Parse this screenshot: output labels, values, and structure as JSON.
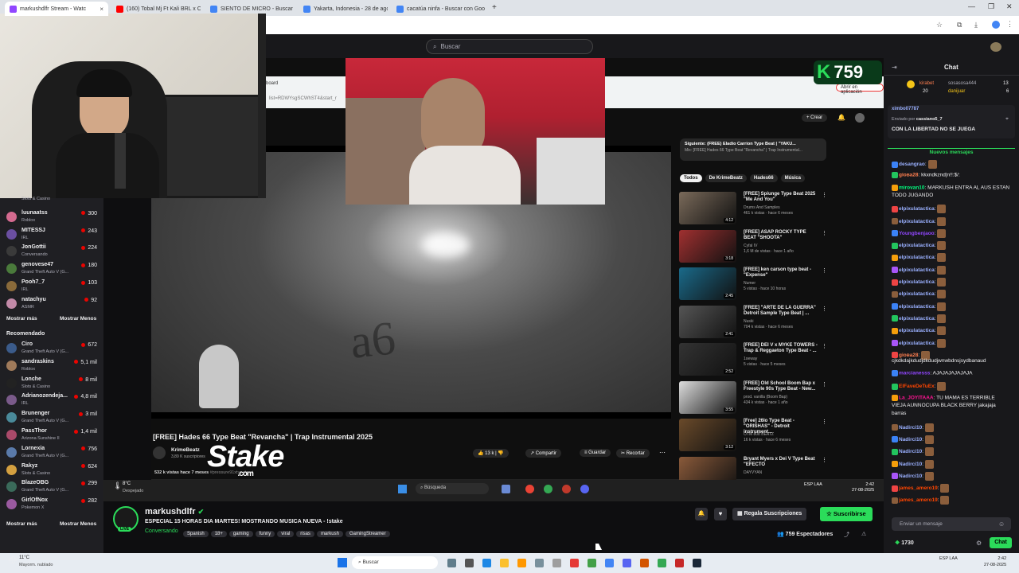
{
  "browser": {
    "tabs": [
      {
        "label": "markushdlfr Stream - Watc",
        "color": "#9146ff",
        "active": true
      },
      {
        "label": "(160) Tobal Mj Ft Kali BRL x Cri",
        "color": "#ff0000",
        "active": false
      },
      {
        "label": "SIENTO DE MICRO - Buscar con",
        "color": "#4285f4",
        "active": false
      },
      {
        "label": "Yakarta, Indonesia - 28 de agos",
        "color": "#4285f4",
        "active": false
      },
      {
        "label": "cacatúa ninfa - Buscar con Goo",
        "color": "#4285f4",
        "active": false
      }
    ]
  },
  "twitch": {
    "search_placeholder": "Buscar",
    "chat_title": "Chat",
    "sidebar": {
      "followed": [
        {
          "name": "",
          "game": "Slots & Casino",
          "viewers": "",
          "color": "#5c4b3a"
        },
        {
          "name": "luunaatss",
          "game": "Roblox",
          "viewers": "300",
          "color": "#d46a8f"
        },
        {
          "name": "MITESSJ",
          "game": "IRL",
          "viewers": "243",
          "color": "#6b4fa1"
        },
        {
          "name": "JonGottii",
          "game": "Conversando",
          "viewers": "224",
          "color": "#3a3a3a"
        },
        {
          "name": "genovese47",
          "game": "Grand Theft Auto V (G...",
          "viewers": "180",
          "color": "#4a7a3b"
        },
        {
          "name": "Pooh7_7",
          "game": "IRL",
          "viewers": "103",
          "color": "#8a6a3a"
        },
        {
          "name": "natachyu",
          "game": "ASMR",
          "viewers": "92",
          "color": "#c28aa8"
        }
      ],
      "show_more": "Mostrar más",
      "show_less": "Mostrar Menos",
      "recommended_title": "Recomendado",
      "recommended": [
        {
          "name": "Ciro",
          "game": "Grand Theft Auto V (G...",
          "viewers": "672",
          "color": "#3b5b8a"
        },
        {
          "name": "sandraskins",
          "game": "Roblox",
          "viewers": "5,1 mil",
          "color": "#a07a5a"
        },
        {
          "name": "Lonche",
          "game": "Slots & Casino",
          "viewers": "8 mil",
          "color": "#222"
        },
        {
          "name": "Adrianozendeja...",
          "game": "IRL",
          "viewers": "4,8 mil",
          "color": "#7a5a8a"
        },
        {
          "name": "Brunenger",
          "game": "Grand Theft Auto V (G...",
          "viewers": "3 mil",
          "color": "#4a8a9a"
        },
        {
          "name": "PassThor",
          "game": "Arizona Sunshine II",
          "viewers": "1,4 mil",
          "color": "#aa4a6a"
        },
        {
          "name": "Lornexia",
          "game": "Grand Theft Auto V (G...",
          "viewers": "756",
          "color": "#5a7aaa"
        },
        {
          "name": "Rakyz",
          "game": "Slots & Casino",
          "viewers": "624",
          "color": "#d4a040"
        },
        {
          "name": "BlazeOBG",
          "game": "Grand Theft Auto V (G...",
          "viewers": "299",
          "color": "#3a6a5a"
        },
        {
          "name": "GirlOfNox",
          "game": "Pokemon X",
          "viewers": "282",
          "color": "#9a5aa0"
        }
      ]
    },
    "stream": {
      "streamer": "markushdlfr",
      "title": "ESPECIAL 15 HORAS DIA MARTES! MOSTRANDO MUSICA NUEVA - !stake",
      "category": "Conversando",
      "tags": [
        "Spanish",
        "18+",
        "gaming",
        "funny",
        "viral",
        "risas",
        "markush",
        "GamingStreamer"
      ],
      "subs_button": "Regala Suscripciones",
      "subscribe_button": "Suscribirse",
      "viewers": "759 Espectadores",
      "live_badge": "LIVE",
      "overlay_count": "759",
      "overlay_logo": "Stake",
      "overlay_logo_sub": ".com"
    },
    "chat": {
      "leaderboard": [
        {
          "name": "kirabet",
          "value": "20"
        },
        {
          "name": "sosasosa444",
          "value": "13"
        },
        {
          "name": "danijuar",
          "value": "6"
        }
      ],
      "pinned_from": "Enviado por",
      "pinned_user": "cassiano5_7",
      "pinned_text": "CON LA LIBERTAD NO SE JUEGA",
      "pinned_user_above": "ximbo07787",
      "new_messages": "Nuevos mensajes",
      "messages": [
        {
          "user": "desangrao",
          "text": "",
          "color": "#9ab0ff"
        },
        {
          "user": "gioва28",
          "text": "kkxndkznd|n!!:$/:",
          "color": "#ff7f50"
        },
        {
          "user": "mirovan10",
          "text": "MARKUSH ENTRA AL AUS ESTAN",
          "color": "#00ff7f"
        },
        {
          "user": "",
          "text": "TODO JUGANDO",
          "color": "#efeff1"
        },
        {
          "user": "elpixulatactica",
          "text": "",
          "color": "#9ab0ff"
        },
        {
          "user": "elpixulatactica",
          "text": "",
          "color": "#9ab0ff"
        },
        {
          "user": "Youngbenjaoo",
          "text": "",
          "color": "#9146ff"
        },
        {
          "user": "elpixulatactica",
          "text": "",
          "color": "#9ab0ff"
        },
        {
          "user": "elpixulatactica",
          "text": "",
          "color": "#9ab0ff"
        },
        {
          "user": "elpixulatactica",
          "text": "",
          "color": "#9ab0ff"
        },
        {
          "user": "elpixulatactica",
          "text": "",
          "color": "#9ab0ff"
        },
        {
          "user": "elpixulatactica",
          "text": "",
          "color": "#9ab0ff"
        },
        {
          "user": "elpixulatactica",
          "text": "",
          "color": "#9ab0ff"
        },
        {
          "user": "elpixulatactica",
          "text": "",
          "color": "#9ab0ff"
        },
        {
          "user": "elpixulatactica",
          "text": "",
          "color": "#9ab0ff"
        },
        {
          "user": "elpixulatactica",
          "text": "",
          "color": "#9ab0ff"
        },
        {
          "user": "gioва28",
          "text": "",
          "color": "#ff7f50"
        },
        {
          "user": "",
          "text": "cjkdkdajkdudjdkdudjwnwbdnsjsydbanaud",
          "color": "#efeff1"
        },
        {
          "user": "marcianesss",
          "text": "AJAJAJAJAJAJA",
          "color": "#9146ff"
        },
        {
          "user": "ElFaveDeTuEx",
          "text": "",
          "color": "#ff4500"
        },
        {
          "user": "La_JOYITAAA",
          "text": "TU MAMA ES TERRIBLE",
          "color": "#ff1493"
        },
        {
          "user": "",
          "text": "VIEJA AUNNOCUPA BLACK BERRY jakajaja",
          "color": "#efeff1"
        },
        {
          "user": "",
          "text": "barras",
          "color": "#efeff1"
        },
        {
          "user": "Nadirci10",
          "text": "",
          "color": "#9ab0ff"
        },
        {
          "user": "Nadirci10",
          "text": "",
          "color": "#9ab0ff"
        },
        {
          "user": "Nadirci10",
          "text": "",
          "color": "#9ab0ff"
        },
        {
          "user": "Nadirci10",
          "text": "",
          "color": "#9ab0ff"
        },
        {
          "user": "Nadirci10",
          "text": "",
          "color": "#9ab0ff"
        },
        {
          "user": "james_amero19",
          "text": "",
          "color": "#ff4500"
        },
        {
          "user": "james_amero19",
          "text": "",
          "color": "#ff4500"
        }
      ],
      "input_placeholder": "Enviar un mensaje",
      "points": "1730",
      "send_button": "Chat"
    }
  },
  "youtube": {
    "create": "Crear",
    "open_in_app": "Abrir en aplicación",
    "next_label": "Siguiente: (FREE) Eladio Carrion Type Beat | \"YAKU...",
    "next_sub": "Mix: [FREE] Hades 66 Type Beat \"Revancha\" | Trap Instrumental...",
    "chips": [
      "Todos",
      "De KrimeBeatz",
      "Hades66",
      "Música"
    ],
    "video_title": "[FREE] Hades 66 Type Beat \"Revancha\" | Trap Instrumental 2025",
    "channel": "KrimeBeatz",
    "subs": "3,89 K suscriptores",
    "subscribe": "Suscribirse",
    "likes": "13 k",
    "share": "Compartir",
    "save": "Guardar",
    "clip": "Recortar",
    "views_line": "532 k vistas  hace 7 meses",
    "hashtags": "#pressure91xtypebeat",
    "related": [
      {
        "title": "[FREE] Spiunge Type Beat 2025 \"Me And You\"",
        "channel": "Drums And Samples",
        "meta": "461 k vistas · hace 6 meses",
        "dur": "4:12",
        "color": "#7a6a5a"
      },
      {
        "title": "[FREE] ASAP ROCKY TYPE BEAT \"SHOOTA\"",
        "channel": "Cyfal IV",
        "meta": "1,6 M de vistas · hace 1 año",
        "dur": "3:18",
        "color": "#a03030"
      },
      {
        "title": "[FREE] ken carson type beat - \"Expense\"",
        "channel": "Numer",
        "meta": "5 vistas · hace 10 horas",
        "dur": "2:45",
        "color": "#1a6a8a"
      },
      {
        "title": "[FREE] \"ARTE DE LA GUERRA\" Detroit Sample Type Beat | ...",
        "channel": "Nuski",
        "meta": "704 k vistas · hace 6 meses",
        "dur": "2:41",
        "color": "#555"
      },
      {
        "title": "[FREE] DEI V x MYKE TOWERS - Trap & Reggaeton Type Beat - ...",
        "channel": "1oeway",
        "meta": "5 vistas · hace 5 meses",
        "dur": "2:52",
        "color": "#333"
      },
      {
        "title": "[FREE] Old School Boom Bap x Freestyle 90s Type Beat - New...",
        "channel": "prod. vanilla (Boom Bap)",
        "meta": "434 k vistas · hace 1 año",
        "dur": "3:55",
        "color": "#ddd"
      },
      {
        "title": "[Free] 26lo Type Beat - \"ORISHAS\" - Detroit instrument...",
        "channel": "OTM 808 BEATZ",
        "meta": "16 k vistas · hace 6 meses",
        "dur": "3:12",
        "color": "#6a4a2a"
      },
      {
        "title": "Bryant Myers x Dei V Type Beat \"EFECTO",
        "channel": "DAYVYAN",
        "meta": "",
        "dur": "",
        "color": "#8a5a3a"
      }
    ]
  },
  "inner_taskbar": {
    "weather_temp": "8°C",
    "weather_text": "Despejado",
    "search": "Búsqueda",
    "lang": "ESP LAA",
    "time": "2:42",
    "date": "27-08-2025"
  },
  "taskbar": {
    "weather_temp": "11°C",
    "weather_text": "Mayorm. nublado",
    "search": "Buscar",
    "lang": "ESP LAA",
    "time": "2:42",
    "date": "27-08-2025"
  }
}
